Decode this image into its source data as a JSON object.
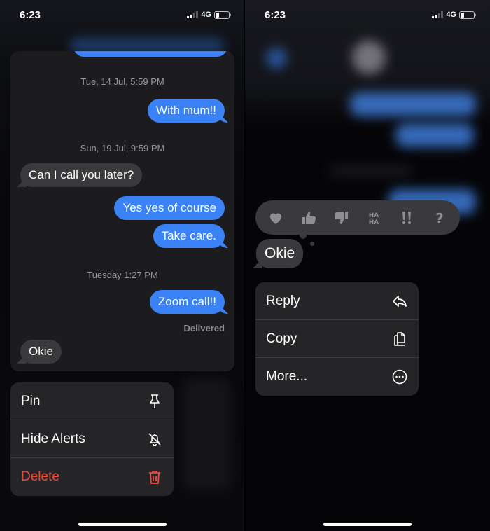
{
  "left": {
    "status_bar": {
      "time": "6:23",
      "network": "4G",
      "signal_bars": 2,
      "signal_total": 4,
      "battery_level": 0.25
    },
    "preview": {
      "messages": [
        {
          "type": "timestamp",
          "text": "Tue, 14 Jul, 5:59 PM"
        },
        {
          "type": "outgoing",
          "text": "With mum!!"
        },
        {
          "type": "timestamp",
          "text": "Sun, 19 Jul, 9:59 PM"
        },
        {
          "type": "incoming",
          "text": "Can I call you later?"
        },
        {
          "type": "outgoing",
          "text": "Yes yes of course"
        },
        {
          "type": "outgoing",
          "text": "Take care."
        },
        {
          "type": "timestamp",
          "text": "Tuesday 1:27 PM"
        },
        {
          "type": "outgoing",
          "text": "Zoom call!!"
        },
        {
          "type": "status",
          "text": "Delivered"
        },
        {
          "type": "incoming",
          "text": "Okie"
        }
      ]
    },
    "menu": {
      "items": [
        {
          "label": "Pin",
          "icon": "pin-icon"
        },
        {
          "label": "Hide Alerts",
          "icon": "bell-slash-icon"
        },
        {
          "label": "Delete",
          "icon": "trash-icon",
          "destructive": true
        }
      ]
    }
  },
  "right": {
    "status_bar": {
      "time": "6:23",
      "network": "4G",
      "signal_bars": 2,
      "signal_total": 4,
      "battery_level": 0.25
    },
    "reactions": [
      {
        "name": "heart",
        "icon": "heart-icon"
      },
      {
        "name": "thumbs-up",
        "icon": "thumbs-up-icon"
      },
      {
        "name": "thumbs-down",
        "icon": "thumbs-down-icon"
      },
      {
        "name": "haha",
        "icon": "haha-icon",
        "text": "HA HA"
      },
      {
        "name": "emphasize",
        "icon": "double-exclamation-icon",
        "text": "!!"
      },
      {
        "name": "question",
        "icon": "question-icon",
        "text": "?"
      }
    ],
    "selected_message": {
      "text": "Okie"
    },
    "menu": {
      "items": [
        {
          "label": "Reply",
          "icon": "reply-icon"
        },
        {
          "label": "Copy",
          "icon": "copy-icon"
        },
        {
          "label": "More...",
          "icon": "more-icon"
        }
      ]
    }
  },
  "colors": {
    "outgoing_bubble": "#3b82f6",
    "incoming_bubble": "#3a3a3c",
    "destructive": "#eb4d3d",
    "menu_bg": "#252527"
  }
}
